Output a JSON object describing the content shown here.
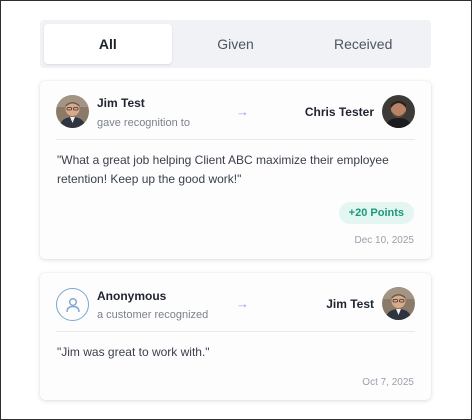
{
  "tabs": [
    {
      "label": "All",
      "active": true
    },
    {
      "label": "Given",
      "active": false
    },
    {
      "label": "Received",
      "active": false
    }
  ],
  "feed": [
    {
      "sender": {
        "name": "Jim Test",
        "caption": "gave recognition to",
        "avatar": "photo-avatar"
      },
      "arrow": "→",
      "recipient": {
        "name": "Chris Tester",
        "avatar": "photo-avatar"
      },
      "message": "\"What a great job helping Client ABC maximize their employee retention! Keep up the good work!\"",
      "points": "+20 Points",
      "date": "Dec 10, 2025"
    },
    {
      "sender": {
        "name": "Anonymous",
        "caption": "a customer recognized",
        "avatar": "user-outline-icon"
      },
      "arrow": "→",
      "recipient": {
        "name": "Jim Test",
        "avatar": "photo-avatar"
      },
      "message": "\"Jim was great to work with.\"",
      "date": "Oct 7, 2025"
    }
  ],
  "colors": {
    "tab_bar_bg": "#f0f2f6",
    "points_badge_bg": "#e3f6f1",
    "points_badge_text": "#1c9a78",
    "arrow": "#9aa9e0",
    "anonymous_icon": "#7ea6cf"
  }
}
